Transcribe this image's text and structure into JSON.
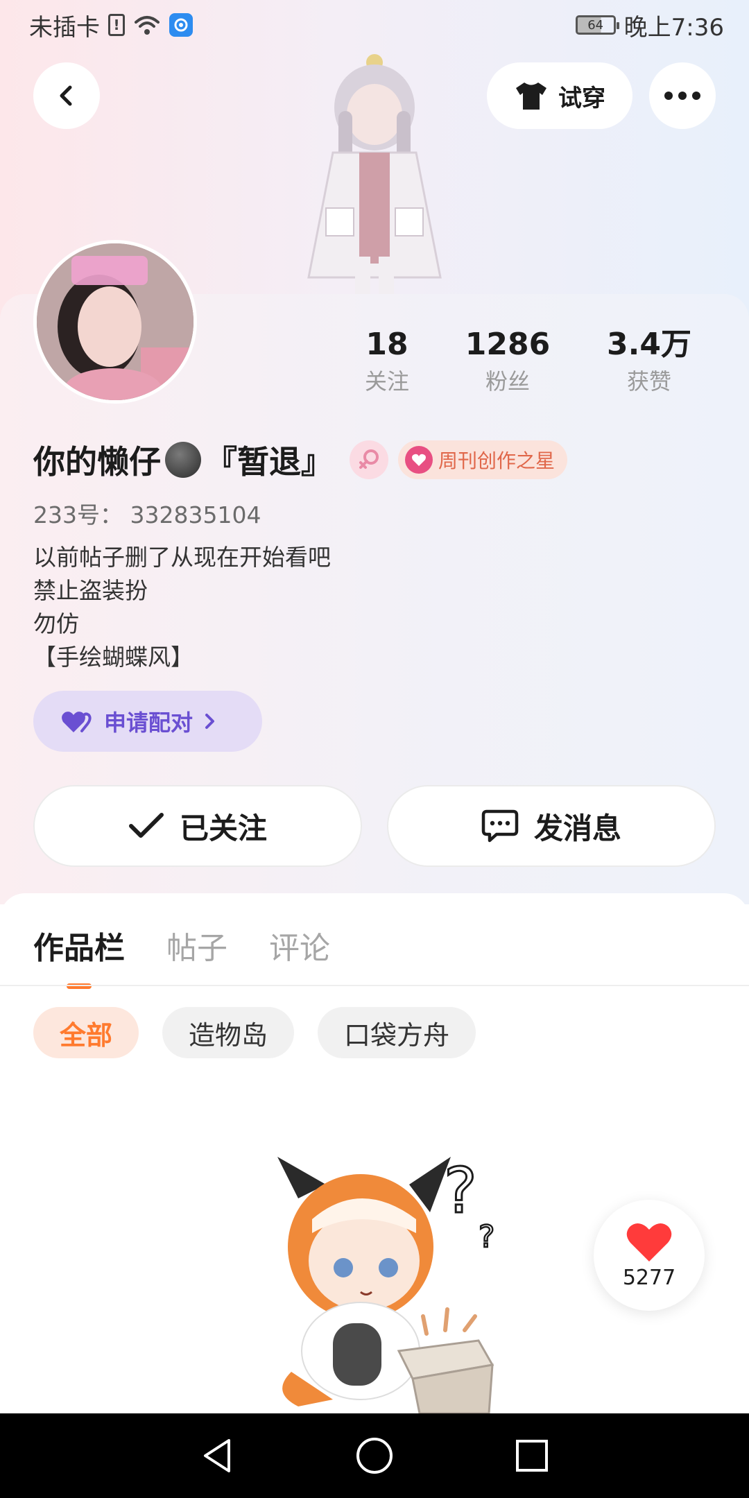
{
  "status_bar": {
    "carrier": "未插卡",
    "sim_icon_text": "!",
    "battery": "64",
    "time": "晚上7:36"
  },
  "header": {
    "tryon_label": "试穿"
  },
  "stats": [
    {
      "value": "18",
      "label": "关注"
    },
    {
      "value": "1286",
      "label": "粉丝"
    },
    {
      "value": "3.4万",
      "label": "获赞"
    }
  ],
  "profile": {
    "name_part1": "你的懒仔",
    "name_part2": "『暂退』",
    "badge_label": "周刊创作之星",
    "uid": "233号：  332835104",
    "bio": [
      "以前帖子删了从现在开始看吧",
      "禁止盗装扮",
      "勿仿",
      "【手绘蝴蝶风】"
    ],
    "pair_label": "申请配对"
  },
  "actions": {
    "follow_label": "已关注",
    "message_label": "发消息"
  },
  "tabs": [
    "作品栏",
    "帖子",
    "评论"
  ],
  "chips": [
    "全部",
    "造物岛",
    "口袋方舟"
  ],
  "likes": {
    "count": "5277"
  },
  "colors": {
    "accent": "#ff7a2e",
    "pair_purple": "#6a4fd2",
    "like_red": "#ff3b3b"
  }
}
